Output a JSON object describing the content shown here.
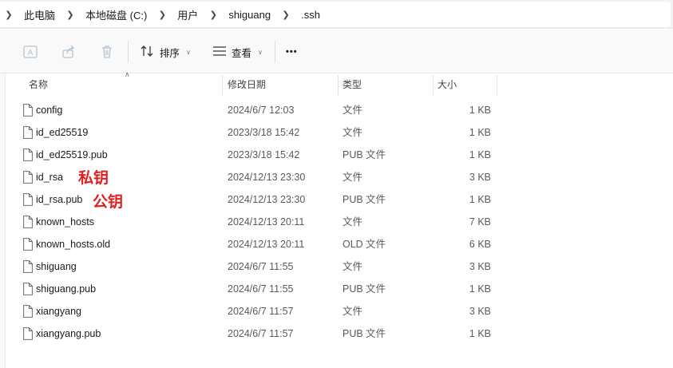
{
  "breadcrumb": [
    "此电脑",
    "本地磁盘 (C:)",
    "用户",
    "shiguang",
    ".ssh"
  ],
  "toolbar": {
    "sort_label": "排序",
    "view_label": "查看",
    "more_label": "•••",
    "icons": [
      "rename-icon",
      "share-icon",
      "delete-icon",
      "sort-icon",
      "view-icon",
      "more-icon"
    ]
  },
  "columns": {
    "name": "名称",
    "date": "修改日期",
    "type": "类型",
    "size": "大小"
  },
  "files": [
    {
      "name": "config",
      "date": "2024/6/7 12:03",
      "type": "文件",
      "size": "1 KB"
    },
    {
      "name": "id_ed25519",
      "date": "2023/3/18 15:42",
      "type": "文件",
      "size": "1 KB"
    },
    {
      "name": "id_ed25519.pub",
      "date": "2023/3/18 15:42",
      "type": "PUB 文件",
      "size": "1 KB"
    },
    {
      "name": "id_rsa",
      "date": "2024/12/13 23:30",
      "type": "文件",
      "size": "3 KB"
    },
    {
      "name": "id_rsa.pub",
      "date": "2024/12/13 23:30",
      "type": "PUB 文件",
      "size": "1 KB"
    },
    {
      "name": "known_hosts",
      "date": "2024/12/13 20:11",
      "type": "文件",
      "size": "7 KB"
    },
    {
      "name": "known_hosts.old",
      "date": "2024/12/13 20:11",
      "type": "OLD 文件",
      "size": "6 KB"
    },
    {
      "name": "shiguang",
      "date": "2024/6/7 11:55",
      "type": "文件",
      "size": "3 KB"
    },
    {
      "name": "shiguang.pub",
      "date": "2024/6/7 11:55",
      "type": "PUB 文件",
      "size": "1 KB"
    },
    {
      "name": "xiangyang",
      "date": "2024/6/7 11:57",
      "type": "文件",
      "size": "3 KB"
    },
    {
      "name": "xiangyang.pub",
      "date": "2024/6/7 11:57",
      "type": "PUB 文件",
      "size": "1 KB"
    }
  ],
  "annotations": {
    "private_key": "私钥",
    "public_key": "公钥",
    "color": "#e02020"
  },
  "colors": {
    "address_bar_bg": "#f3f3f3",
    "toolbar_bg": "#f9f9f9",
    "disabled_icon": "#b8c4d0"
  }
}
